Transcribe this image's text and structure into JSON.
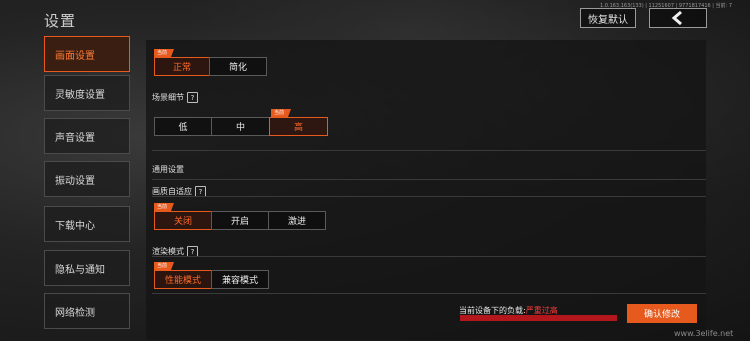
{
  "header": {
    "title": "设置",
    "version": "1.0.163.163(133) | 11251607 | 9771817416 | 当前: 7",
    "reset_label": "恢复默认",
    "back_icon": "chevron-left-icon"
  },
  "sidebar": {
    "items": [
      {
        "label": "画面设置",
        "active": true
      },
      {
        "label": "灵敏度设置",
        "active": false
      },
      {
        "label": "声音设置",
        "active": false
      },
      {
        "label": "振动设置",
        "active": false
      },
      {
        "label": "下载中心",
        "active": false
      },
      {
        "label": "隐私与通知",
        "active": false
      },
      {
        "label": "网络检测",
        "active": false
      }
    ]
  },
  "main": {
    "current_tag": "当前",
    "quality": {
      "options": [
        "正常",
        "简化"
      ],
      "selected": "正常"
    },
    "scene_detail": {
      "label": "场景细节",
      "help": "?",
      "options": [
        "低",
        "中",
        "高"
      ],
      "selected": "高"
    },
    "general": {
      "label": "通用设置"
    },
    "adaptive": {
      "label": "画质自适应",
      "help": "?",
      "options": [
        "关闭",
        "开启",
        "激进"
      ],
      "selected": "关闭"
    },
    "render_mode": {
      "label": "渲染模式",
      "help": "?",
      "options": [
        "性能模式",
        "兼容模式"
      ],
      "selected": "性能模式"
    }
  },
  "footer": {
    "load_label": "当前设备下的负载:",
    "load_value": "严重过高",
    "load_fraction": 1.0,
    "load_color": "#b3171c",
    "confirm_label": "确认修改"
  },
  "watermark": "www.3elife.net",
  "colors": {
    "accent": "#e65a1e",
    "danger": "#ff3c3c"
  }
}
